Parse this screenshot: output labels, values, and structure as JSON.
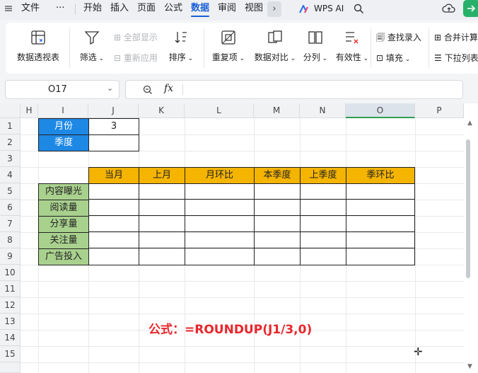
{
  "menu": {
    "file": "文件",
    "more": "···",
    "tabs": [
      "开始",
      "插入",
      "页面",
      "公式",
      "数据",
      "审阅",
      "视图"
    ],
    "wps_ai": "WPS AI"
  },
  "ribbon": {
    "pivot": "数据透视表",
    "filter": "筛选",
    "show_all": "全部显示",
    "reapply": "重新应用",
    "sort": "排序",
    "duplicates": "重复项",
    "compare": "数据对比",
    "split": "分列",
    "validity": "有效性",
    "find_entry": "查找录入",
    "fill": "填充",
    "merge_calc": "合并计算",
    "dropdown_list": "下拉列表"
  },
  "name_box": "O17",
  "formula_bar": {
    "fx": "fx",
    "value": ""
  },
  "columns": [
    "H",
    "I",
    "J",
    "K",
    "L",
    "M",
    "N",
    "O",
    "P"
  ],
  "rows": [
    "1",
    "2",
    "3",
    "4",
    "5",
    "6",
    "7",
    "8",
    "9",
    "10",
    "11",
    "12",
    "13",
    "14",
    "15"
  ],
  "cells": {
    "month_label": "月份",
    "month_value": "3",
    "quarter_label": "季度",
    "table_headers": [
      "当月",
      "上月",
      "月环比",
      "本季度",
      "上季度",
      "季环比"
    ],
    "row_labels": [
      "内容曝光",
      "阅读量",
      "分享量",
      "关注量",
      "广告投入"
    ]
  },
  "annotation": "公式：=ROUNDUP(J1/3,0)",
  "colors": {
    "orange_header": "#f5b400",
    "blue_label": "#1e88e5",
    "green_label": "#a9d18e",
    "red_text": "#e8272c"
  }
}
